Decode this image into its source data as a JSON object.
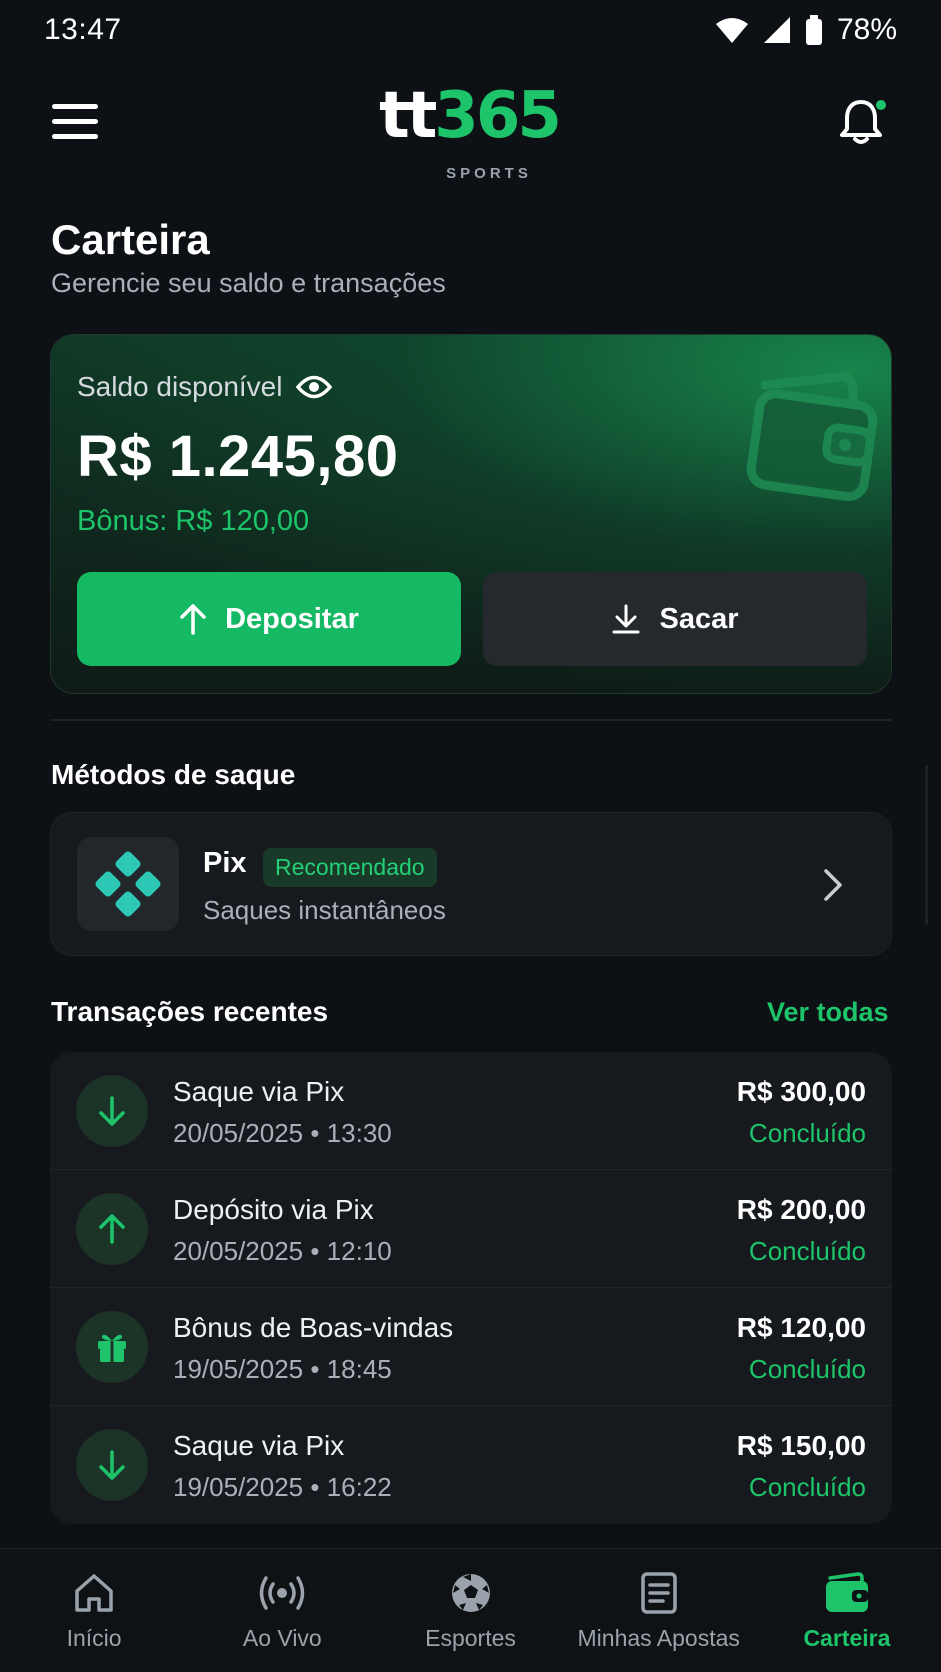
{
  "status_bar": {
    "time": "13:47",
    "battery": "78%"
  },
  "header": {
    "logo_main": "tt",
    "logo_num": "365",
    "logo_sub": "SPORTS"
  },
  "page": {
    "title": "Carteira",
    "subtitle": "Gerencie seu saldo e transações"
  },
  "balance": {
    "label": "Saldo disponível",
    "value": "R$ 1.245,80",
    "bonus": "Bônus: R$ 120,00",
    "deposit_label": "Depositar",
    "withdraw_label": "Sacar"
  },
  "withdraw_methods": {
    "title": "Métodos de saque",
    "pix": {
      "name": "Pix",
      "badge": "Recomendado",
      "description": "Saques instantâneos"
    }
  },
  "transactions": {
    "title": "Transações recentes",
    "see_all": "Ver todas",
    "items": [
      {
        "title": "Saque via Pix",
        "date": "20/05/2025 • 13:30",
        "amount": "R$ 300,00",
        "status": "Concluído",
        "icon": "arrow-down-icon"
      },
      {
        "title": "Depósito via Pix",
        "date": "20/05/2025 • 12:10",
        "amount": "R$ 200,00",
        "status": "Concluído",
        "icon": "arrow-up-icon"
      },
      {
        "title": "Bônus de Boas-vindas",
        "date": "19/05/2025 • 18:45",
        "amount": "R$ 120,00",
        "status": "Concluído",
        "icon": "gift-icon"
      },
      {
        "title": "Saque via Pix",
        "date": "19/05/2025 • 16:22",
        "amount": "R$ 150,00",
        "status": "Concluído",
        "icon": "arrow-down-icon"
      }
    ]
  },
  "bottom_nav": {
    "items": [
      {
        "label": "Início",
        "icon": "home-icon"
      },
      {
        "label": "Ao Vivo",
        "icon": "broadcast-icon"
      },
      {
        "label": "Esportes",
        "icon": "soccer-ball-icon"
      },
      {
        "label": "Minhas Apostas",
        "icon": "document-icon"
      },
      {
        "label": "Carteira",
        "icon": "wallet-icon",
        "active": true
      }
    ]
  },
  "colors": {
    "accent": "#1dc46a",
    "background": "#0d1014",
    "card": "#161a1e"
  }
}
